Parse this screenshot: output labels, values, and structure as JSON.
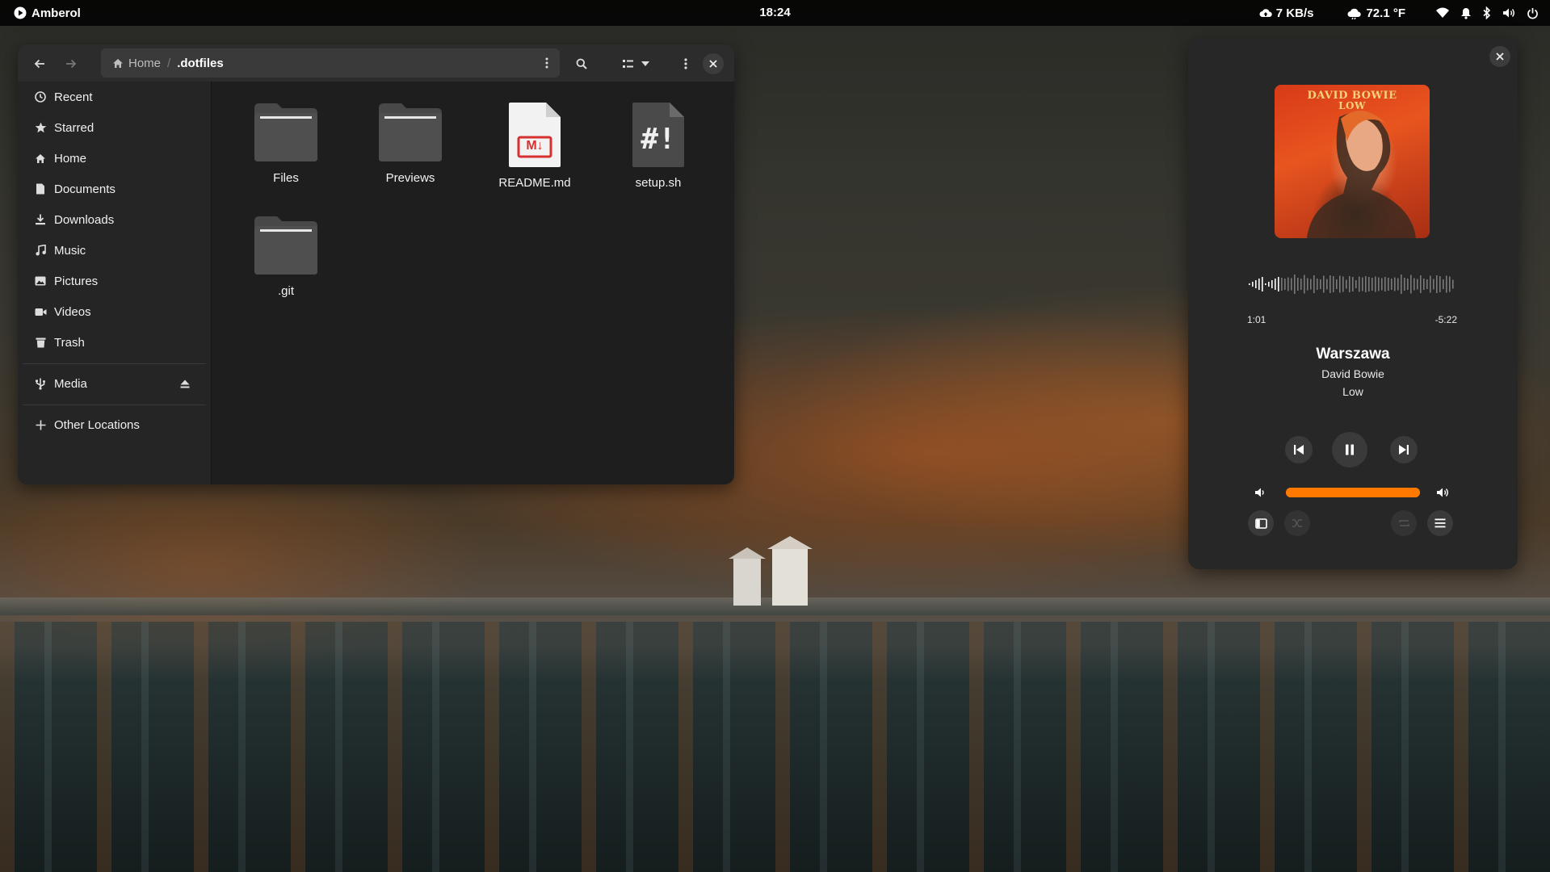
{
  "topbar": {
    "app_name": "Amberol",
    "clock": "18:24",
    "network_speed": "7 KB/s",
    "weather": "72.1 °F",
    "icons": [
      "play-icon",
      "cloud-upload-icon",
      "weather-cloud-icon",
      "wifi-icon",
      "bell-icon",
      "bluetooth-icon",
      "volume-icon",
      "power-icon"
    ]
  },
  "files": {
    "path": {
      "home": "Home",
      "current": ".dotfiles"
    },
    "sidebar": {
      "items": [
        {
          "label": "Recent",
          "icon": "clock-icon"
        },
        {
          "label": "Starred",
          "icon": "star-icon"
        },
        {
          "label": "Home",
          "icon": "home-icon"
        },
        {
          "label": "Documents",
          "icon": "document-icon"
        },
        {
          "label": "Downloads",
          "icon": "download-icon"
        },
        {
          "label": "Music",
          "icon": "music-icon"
        },
        {
          "label": "Pictures",
          "icon": "picture-icon"
        },
        {
          "label": "Videos",
          "icon": "video-icon"
        },
        {
          "label": "Trash",
          "icon": "trash-icon"
        }
      ],
      "media": "Media",
      "other": "Other Locations"
    },
    "items": [
      {
        "name": "Files",
        "type": "folder"
      },
      {
        "name": "Previews",
        "type": "folder"
      },
      {
        "name": "README.md",
        "type": "markdown"
      },
      {
        "name": "setup.sh",
        "type": "script"
      },
      {
        "name": ".git",
        "type": "folder"
      }
    ],
    "markdown_badge": "M↓",
    "script_badge": "#!"
  },
  "player": {
    "title": "Warszawa",
    "artist": "David Bowie",
    "album": "Low",
    "elapsed": "1:01",
    "remaining": "-5:22",
    "cover_text": [
      "DAVID BOWIE",
      "LOW"
    ],
    "volume": 1.0,
    "accent": "#ff7800"
  }
}
